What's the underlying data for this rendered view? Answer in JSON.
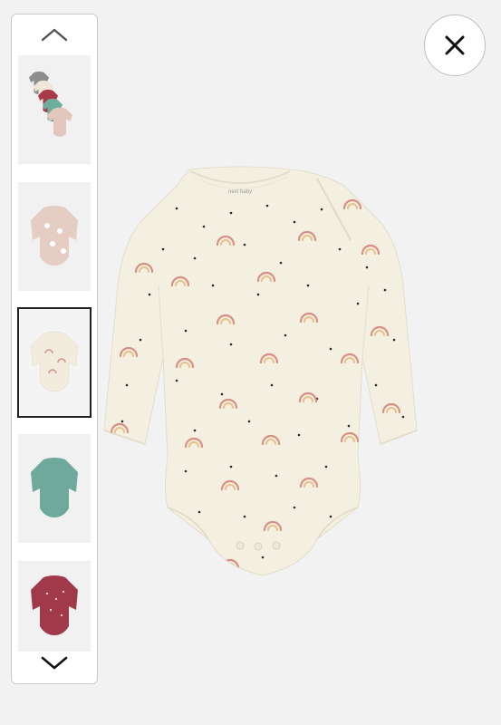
{
  "gallery": {
    "thumbnails": [
      {
        "name": "multipack-all-bodysuits",
        "selected": false
      },
      {
        "name": "pink-sheep-bodysuit",
        "selected": false
      },
      {
        "name": "cream-rainbow-bodysuit",
        "selected": true
      },
      {
        "name": "sage-green-spot-bodysuit",
        "selected": false
      },
      {
        "name": "berry-floral-bodysuit",
        "selected": false
      }
    ],
    "scroll_up_icon": "chevron-up-icon",
    "scroll_down_icon": "chevron-down-icon"
  },
  "close_icon": "close-icon",
  "main_image": {
    "label_text": "next baby",
    "colors": {
      "fabric": "#f3efe1",
      "rainbow_outer": "#d98f82",
      "rainbow_inner": "#e8c08a",
      "dots": "#2b2b2b",
      "selected_border": "#1f1f1f"
    }
  }
}
